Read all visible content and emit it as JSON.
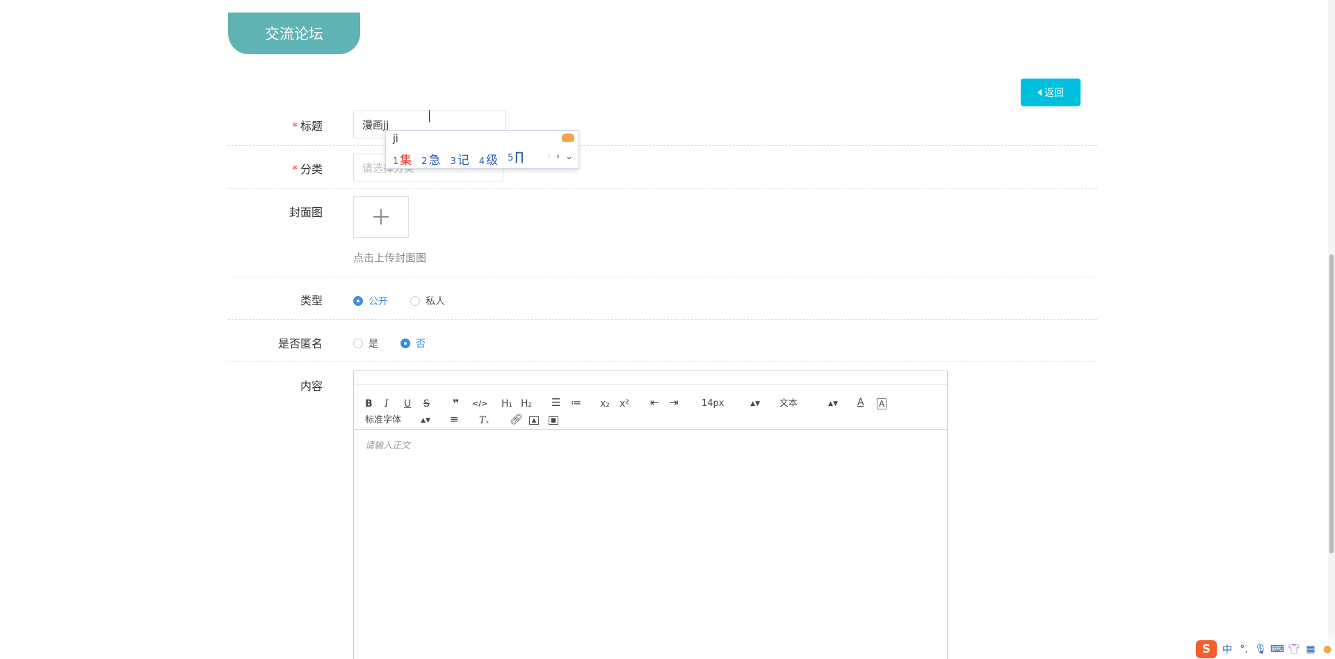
{
  "header": {
    "tab_label": "交流论坛"
  },
  "actions": {
    "back_label": "返回"
  },
  "form": {
    "title": {
      "label": "标题",
      "required_mark": "*",
      "value": "漫画jj"
    },
    "category": {
      "label": "分类",
      "required_mark": "*",
      "placeholder": "请选择分类"
    },
    "cover": {
      "label": "封面图",
      "hint": "点击上传封面图"
    },
    "type": {
      "label": "类型",
      "options": [
        "公开",
        "私人"
      ],
      "selected": "公开"
    },
    "anonymous": {
      "label": "是否匿名",
      "options": [
        "是",
        "否"
      ],
      "selected": "否"
    },
    "content": {
      "label": "内容",
      "placeholder": "请输入正文"
    }
  },
  "ime_popup": {
    "composition": "ji",
    "candidates": [
      {
        "n": "1",
        "text": "集"
      },
      {
        "n": "2",
        "text": "急"
      },
      {
        "n": "3",
        "text": "记"
      },
      {
        "n": "4",
        "text": "级"
      },
      {
        "n": "5",
        "text": "∏"
      }
    ],
    "nav": [
      "‹",
      "›",
      "⌄"
    ]
  },
  "editor_toolbar": {
    "font_size": "14px",
    "header_select": "文本",
    "font_family": "标准字体",
    "buttons": [
      "bold",
      "italic",
      "underline",
      "strike",
      "blockquote",
      "code-block",
      "h1",
      "h2",
      "ordered-list",
      "bullet-list",
      "subscript",
      "superscript",
      "outdent",
      "indent",
      "font-color",
      "background-color",
      "align",
      "clean",
      "link",
      "image",
      "video"
    ]
  },
  "tray": {
    "lang": "中",
    "punct": "°,"
  },
  "colors": {
    "accent_teal": "#5fb3b3",
    "back_button": "#00c0e0",
    "radio_checked": "#3a8ee6",
    "required": "#e64b4b"
  }
}
